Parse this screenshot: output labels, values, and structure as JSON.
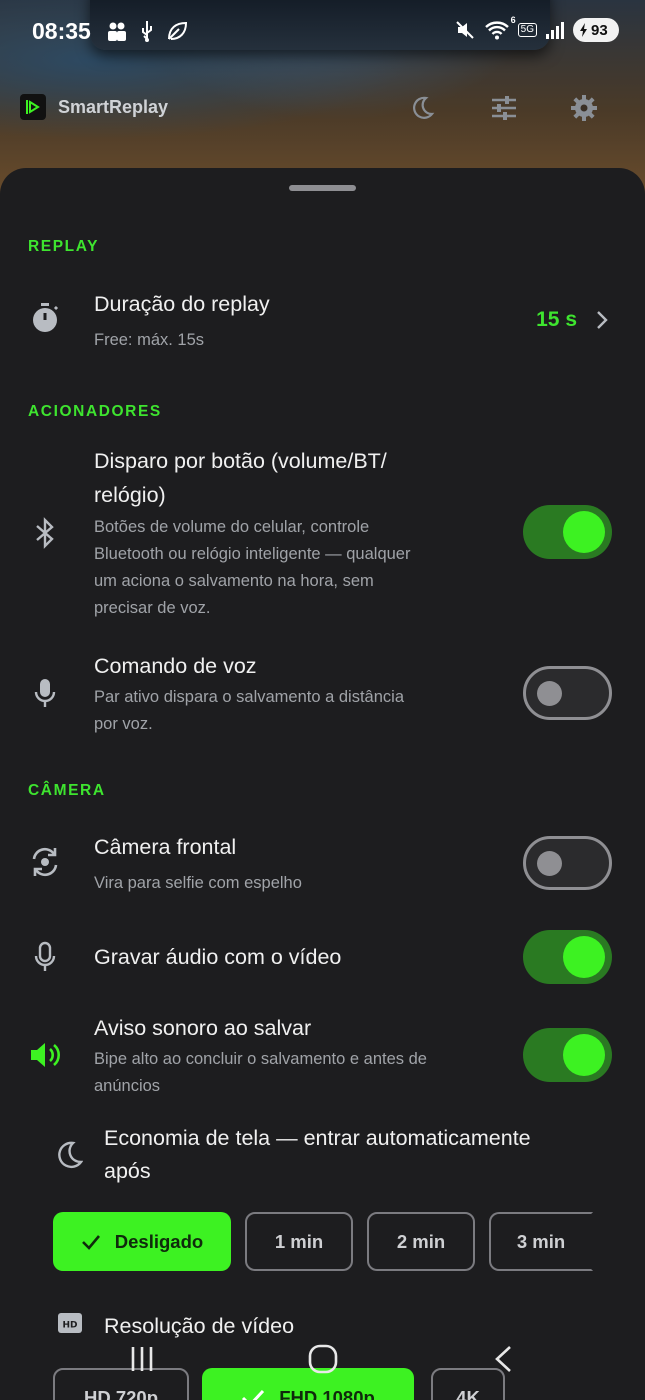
{
  "status": {
    "time": "08:35",
    "network": "5G",
    "wifi_badge": "6",
    "battery": "93"
  },
  "app": {
    "title": "SmartReplay"
  },
  "sections": {
    "replay": "REPLAY",
    "triggers": "ACIONADORES",
    "camera": "CÂMERA"
  },
  "replay_duration": {
    "title": "Duração do replay",
    "subtitle": "Free: máx. 15s",
    "value": "15 s"
  },
  "button_trigger": {
    "title_line1": "Disparo por botão (volume/BT/",
    "title_line2": "relógio)",
    "sub_line1": "Botões de volume do celular, controle",
    "sub_line2": "Bluetooth ou relógio inteligente — qualquer",
    "sub_line3": "um aciona o salvamento na hora, sem",
    "sub_line4": "precisar de voz.",
    "enabled": true
  },
  "voice_command": {
    "title": "Comando de voz",
    "sub_line1": "Par ativo dispara o salvamento a distância",
    "sub_line2": "por voz.",
    "enabled": false
  },
  "front_camera": {
    "title": "Câmera frontal",
    "subtitle": "Vira para selfie com espelho",
    "enabled": false
  },
  "record_audio": {
    "title": "Gravar áudio com o vídeo",
    "enabled": true
  },
  "save_sound": {
    "title": "Aviso sonoro ao salvar",
    "sub_line1": "Bipe alto ao concluir o salvamento e antes de",
    "sub_line2": "anúncios",
    "enabled": true
  },
  "screen_saver": {
    "title_line1": "Economia de tela — entrar automaticamente",
    "title_line2": "após",
    "options": [
      "Desligado",
      "1 min",
      "2 min",
      "3 min"
    ],
    "selected": "Desligado"
  },
  "video_resolution": {
    "title": "Resolução de vídeo",
    "options": [
      "HD 720p",
      "FHD 1080p",
      "4K"
    ],
    "selected": "FHD 1080p"
  },
  "colors": {
    "accent": "#3df222",
    "section_title": "#3ee42f",
    "sheet_bg": "#1d1d1f"
  }
}
